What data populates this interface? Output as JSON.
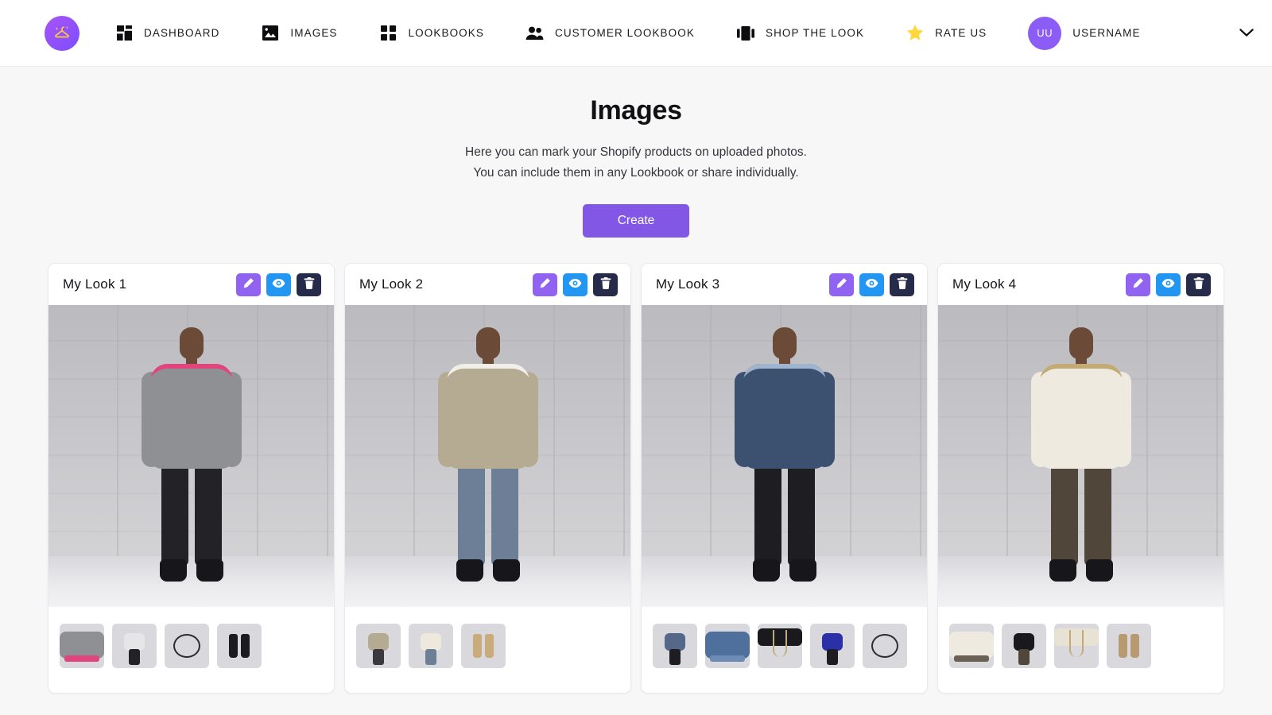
{
  "brand": {
    "logo_icon": "hanger-sparkle-icon"
  },
  "nav": {
    "items": [
      {
        "label": "DASHBOARD",
        "icon": "dashboard-grid-icon"
      },
      {
        "label": "IMAGES",
        "icon": "image-icon"
      },
      {
        "label": "LOOKBOOKS",
        "icon": "grid-four-icon"
      },
      {
        "label": "CUSTOMER LOOKBOOK",
        "icon": "people-icon"
      },
      {
        "label": "SHOP THE LOOK",
        "icon": "carousel-icon"
      },
      {
        "label": "RATE US",
        "icon": "star-icon"
      }
    ],
    "user": {
      "initials": "UU",
      "name": "USERNAME",
      "chevron_icon": "chevron-down-icon"
    }
  },
  "page": {
    "title": "Images",
    "subtitle_line1": "Here you can mark your Shopify products on uploaded photos.",
    "subtitle_line2": "You can include them in any Lookbook or share individually.",
    "create_label": "Create"
  },
  "actions": {
    "edit": {
      "icon": "pencil-icon",
      "color": "#9063f0"
    },
    "view": {
      "icon": "eye-icon",
      "color": "#2196f3"
    },
    "delete": {
      "icon": "trash-icon",
      "color": "#262b4a"
    }
  },
  "colors": {
    "accent_purple": "#8257e5",
    "edit_purple": "#9063f0",
    "view_blue": "#2196f3",
    "delete_navy": "#262b4a",
    "page_bg": "#f7f7f8",
    "card_bg": "#ffffff",
    "logo_gold": "#ffc83d"
  },
  "cards": [
    {
      "title": "My Look 1",
      "photo": {
        "top_color": "#8f9094",
        "bottom_color": "#232327",
        "accent": "#e0457b"
      },
      "thumbs": [
        {
          "name": "grey-sweater-thumb",
          "kind": "top",
          "top": "#8f9094",
          "bottom": "#e0457b"
        },
        {
          "name": "full-outfit-thumb",
          "kind": "figure",
          "top": "#e6e6e8",
          "bottom": "#232327"
        },
        {
          "name": "necklace-thumb",
          "kind": "ring",
          "top": "#cbb085",
          "bottom": "#2d2d31"
        },
        {
          "name": "black-boots-thumb",
          "kind": "boots",
          "top": "#1c1c20",
          "bottom": "#1c1c20"
        }
      ]
    },
    {
      "title": "My Look 2",
      "photo": {
        "top_color": "#b5ab92",
        "bottom_color": "#6d7f96",
        "accent": "#f2efe8"
      },
      "thumbs": [
        {
          "name": "trench-coat-thumb",
          "kind": "figure",
          "top": "#b5ab92",
          "bottom": "#3a3a3e"
        },
        {
          "name": "blue-jeans-thumb",
          "kind": "figure",
          "top": "#efe9dd",
          "bottom": "#6d7f96"
        },
        {
          "name": "tan-boots-thumb",
          "kind": "boots",
          "top": "#c9ab7c",
          "bottom": "#c9ab7c"
        }
      ]
    },
    {
      "title": "My Look 3",
      "photo": {
        "top_color": "#3c5070",
        "bottom_color": "#1e1e22",
        "accent": "#9fb4cf"
      },
      "thumbs": [
        {
          "name": "denim-outfit-thumb",
          "kind": "figure",
          "top": "#56688a",
          "bottom": "#1e1e22"
        },
        {
          "name": "denim-shirt-thumb",
          "kind": "top",
          "top": "#4f6f9c",
          "bottom": "#6d8cb5"
        },
        {
          "name": "black-vneck-thumb",
          "kind": "neck",
          "top": "#1a1a1e",
          "bottom": "#c3a974"
        },
        {
          "name": "blue-sweater-thumb",
          "kind": "figure",
          "top": "#2b2fa8",
          "bottom": "#1e1e22"
        },
        {
          "name": "choker-thumb",
          "kind": "ring",
          "top": "#cbb085",
          "bottom": "#2d2d31"
        }
      ]
    },
    {
      "title": "My Look 4",
      "photo": {
        "top_color": "#efeae0",
        "bottom_color": "#50463a",
        "accent": "#c3a974"
      },
      "thumbs": [
        {
          "name": "amour-sweater-thumb",
          "kind": "top",
          "top": "#efeae0",
          "bottom": "#6a6054"
        },
        {
          "name": "dark-pants-thumb",
          "kind": "figure",
          "top": "#1a1a1e",
          "bottom": "#50463a"
        },
        {
          "name": "gold-necklace-thumb",
          "kind": "neck",
          "top": "#e8e2d5",
          "bottom": "#c3a974"
        },
        {
          "name": "tan-boots-thumb",
          "kind": "boots",
          "top": "#b79a72",
          "bottom": "#b79a72"
        }
      ]
    }
  ]
}
